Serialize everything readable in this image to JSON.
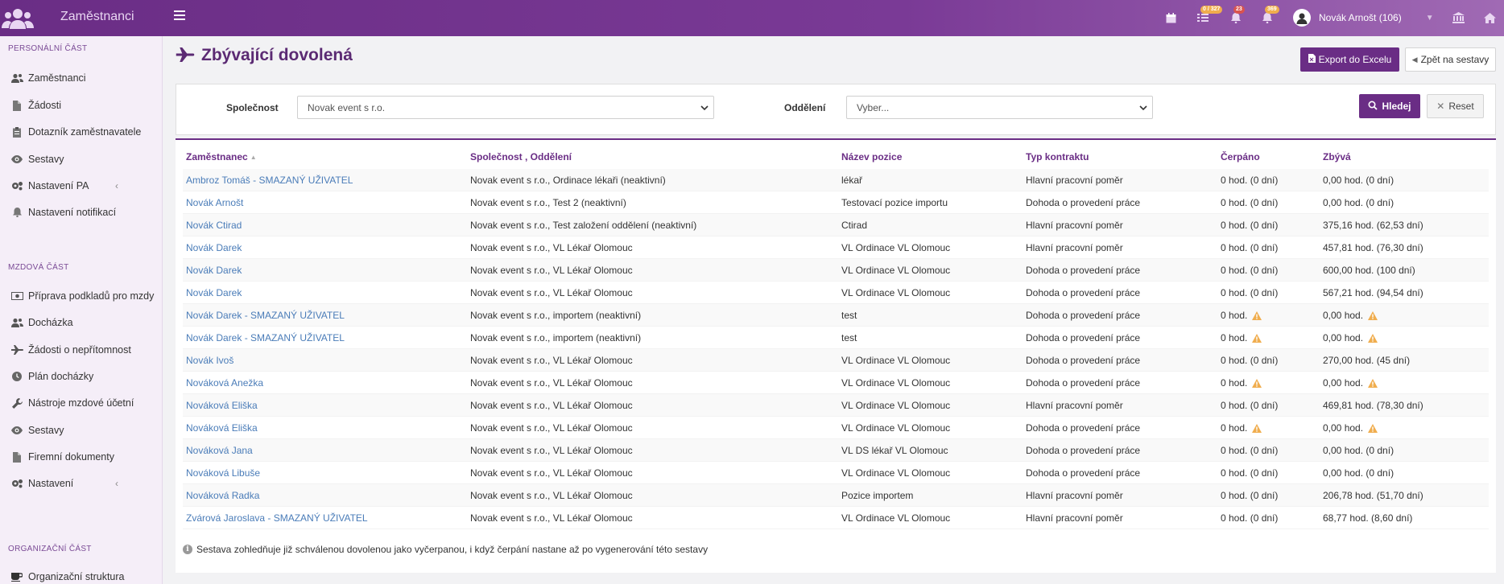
{
  "app": {
    "title": "Zaměstnanci"
  },
  "topbar": {
    "badges": {
      "tasks": "0 / 327",
      "notifications": "23",
      "alerts": "369"
    },
    "user_name": "Novák Arnošt (106)"
  },
  "sidebar": {
    "sections": [
      {
        "label": "PERSONÁLNÍ ČÁST"
      },
      {
        "label": "MZDOVÁ ČÁST"
      },
      {
        "label": "ORGANIZAČNÍ ČÁST"
      }
    ],
    "items": [
      {
        "label": "Zaměstnanci",
        "icon": "users-icon"
      },
      {
        "label": "Žádosti",
        "icon": "document-icon"
      },
      {
        "label": "Dotazník zaměstnavatele",
        "icon": "clipboard-icon"
      },
      {
        "label": "Sestavy",
        "icon": "eye-icon"
      },
      {
        "label": "Nastavení PA",
        "icon": "gears-icon"
      },
      {
        "label": "Nastavení notifikací",
        "icon": "bell-icon"
      },
      {
        "label": "Příprava podkladů pro mzdy",
        "icon": "money-icon"
      },
      {
        "label": "Docházka",
        "icon": "users-icon"
      },
      {
        "label": "Žádosti o nepřítomnost",
        "icon": "plane-icon"
      },
      {
        "label": "Plán docházky",
        "icon": "clock-icon"
      },
      {
        "label": "Nástroje mzdové účetní",
        "icon": "wrench-icon"
      },
      {
        "label": "Sestavy",
        "icon": "eye-icon"
      },
      {
        "label": "Firemní dokumenty",
        "icon": "document-icon"
      },
      {
        "label": "Nastavení",
        "icon": "gears-icon"
      },
      {
        "label": "Organizační struktura",
        "icon": "coffee-icon"
      }
    ]
  },
  "page": {
    "title": "Zbývající dovolená",
    "export_label": "Export do Excelu",
    "back_label": "Zpět na sestavy"
  },
  "filter": {
    "company_label": "Společnost",
    "company_value": "Novak event s r.o.",
    "department_label": "Oddělení",
    "department_placeholder": "Vyber...",
    "search_label": "Hledej",
    "reset_label": "Reset"
  },
  "table": {
    "headers": [
      "Zaměstnanec",
      "Společnost , Oddělení",
      "Název pozice",
      "Typ kontraktu",
      "Čerpáno",
      "Zbývá"
    ],
    "rows": [
      [
        "Ambroz Tomáš - SMAZANÝ UŽIVATEL",
        "Novak event s r.o., Ordinace lékaři (neaktivní)",
        "lékař",
        "Hlavní pracovní poměr",
        "0 hod. (0 dní)",
        "0,00 hod. (0 dní)"
      ],
      [
        "Novák Arnošt",
        "Novak event s r.o., Test 2 (neaktivní)",
        "Testovací pozice importu",
        "Dohoda o provedení práce",
        "0 hod. (0 dní)",
        "0,00 hod. (0 dní)"
      ],
      [
        "Novák Ctirad",
        "Novak event s r.o., Test založení oddělení (neaktivní)",
        "Ctirad",
        "Hlavní pracovní poměr",
        "0 hod. (0 dní)",
        "375,16 hod. (62,53 dní)"
      ],
      [
        "Novák Darek",
        "Novak event s r.o., VL Lékař Olomouc",
        "VL Ordinace VL Olomouc",
        "Hlavní pracovní poměr",
        "0 hod. (0 dní)",
        "457,81 hod. (76,30 dní)"
      ],
      [
        "Novák Darek",
        "Novak event s r.o., VL Lékař Olomouc",
        "VL Ordinace VL Olomouc",
        "Dohoda o provedení práce",
        "0 hod. (0 dní)",
        "600,00 hod. (100 dní)"
      ],
      [
        "Novák Darek",
        "Novak event s r.o., VL Lékař Olomouc",
        "VL Ordinace VL Olomouc",
        "Dohoda o provedení práce",
        "0 hod. (0 dní)",
        "567,21 hod. (94,54 dní)"
      ],
      [
        "Novák Darek - SMAZANÝ UŽIVATEL",
        "Novak event s r.o., importem (neaktivní)",
        "test",
        "Dohoda o provedení práce",
        "0 hod.",
        "0,00 hod."
      ],
      [
        "Novák Darek - SMAZANÝ UŽIVATEL",
        "Novak event s r.o., importem (neaktivní)",
        "test",
        "Dohoda o provedení práce",
        "0 hod.",
        "0,00 hod."
      ],
      [
        "Novák Ivoš",
        "Novak event s r.o., VL Lékař Olomouc",
        "VL Ordinace VL Olomouc",
        "Dohoda o provedení práce",
        "0 hod. (0 dní)",
        "270,00 hod. (45 dní)"
      ],
      [
        "Nováková Anežka",
        "Novak event s r.o., VL Lékař Olomouc",
        "VL Ordinace VL Olomouc",
        "Dohoda o provedení práce",
        "0 hod.",
        "0,00 hod."
      ],
      [
        "Nováková Eliška",
        "Novak event s r.o., VL Lékař Olomouc",
        "VL Ordinace VL Olomouc",
        "Hlavní pracovní poměr",
        "0 hod. (0 dní)",
        "469,81 hod. (78,30 dní)"
      ],
      [
        "Nováková Eliška",
        "Novak event s r.o., VL Lékař Olomouc",
        "VL Ordinace VL Olomouc",
        "Dohoda o provedení práce",
        "0 hod.",
        "0,00 hod."
      ],
      [
        "Nováková Jana",
        "Novak event s r.o., VL Lékař Olomouc",
        "VL DS lékař VL Olomouc",
        "Dohoda o provedení práce",
        "0 hod. (0 dní)",
        "0,00 hod. (0 dní)"
      ],
      [
        "Nováková Libuše",
        "Novak event s r.o., VL Lékař Olomouc",
        "VL Ordinace VL Olomouc",
        "Dohoda o provedení práce",
        "0 hod. (0 dní)",
        "0,00 hod. (0 dní)"
      ],
      [
        "Nováková Radka",
        "Novak event s r.o., VL Lékař Olomouc",
        "Pozice importem",
        "Hlavní pracovní poměr",
        "0 hod. (0 dní)",
        "206,78 hod. (51,70 dní)"
      ],
      [
        "Zvárová Jaroslava - SMAZANÝ UŽIVATEL",
        "Novak event s r.o., VL Lékař Olomouc",
        "VL Ordinace VL Olomouc",
        "Hlavní pracovní poměr",
        "0 hod. (0 dní)",
        "68,77 hod. (8,60 dní)"
      ]
    ],
    "warning_rows": [
      6,
      7,
      9,
      11
    ],
    "note": "Sestava zohledňuje již schválenou dovolenou jako vyčerpanou, i když čerpání nastane až po vygenerování této sestavy"
  },
  "colors": {
    "accent": "#6a2d85",
    "link": "#4a7cb8",
    "warning": "#f0ad4e"
  }
}
